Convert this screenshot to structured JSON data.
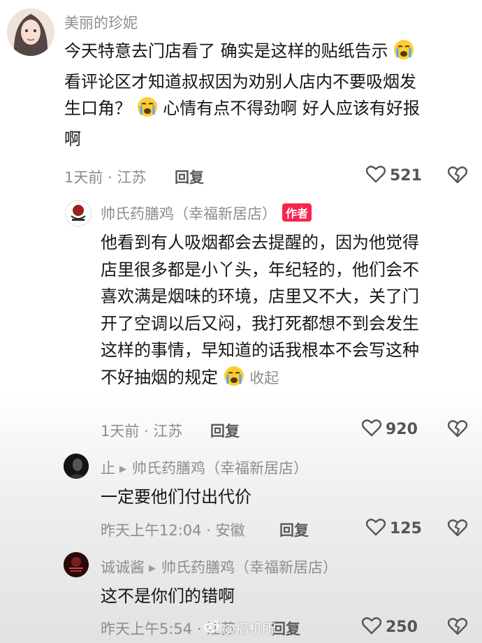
{
  "comments": [
    {
      "username": "美丽的珍妮",
      "text_lines": [
        "今天特意去门店看了 确实是这样的贴纸告示",
        "看评论区才知道叔叔因为劝别人店内不要吸烟发",
        "生口角？",
        "心情有点不得劲啊 好人应该有好报",
        "啊"
      ],
      "time_location": "1天前 · 江苏",
      "reply_label": "回复",
      "likes": "521"
    },
    {
      "username": "帅氏药膳鸡（幸福新居店）",
      "badge": "作者",
      "text_lines": [
        "他看到有人吸烟都会去提醒的，因为他觉得",
        "店里很多都是小丫头，年纪轻的，他们会不",
        "喜欢满是烟味的环境，店里又不大，关了门",
        "开了空调以后又闷，我打死都想不到会发生",
        "这样的事情，早知道的话我根本不会写这种",
        "不好抽烟的规定"
      ],
      "collapse_label": "收起",
      "time_location": "1天前 · 江苏",
      "reply_label": "回复",
      "likes": "920"
    },
    {
      "username": "止",
      "reply_to": "帅氏药膳鸡（幸福新居店）",
      "text": "一定要他们付出代价",
      "time_location": "昨天上午12:04 · 安徽",
      "reply_label": "回复",
      "likes": "125"
    },
    {
      "username": "诚诚酱",
      "reply_to": "帅氏药膳鸡（幸福新居店）",
      "text": "这不是你们的错啊",
      "time_location": "昨天上午5:54 · 江苏",
      "reply_label": "回复",
      "likes": "250"
    }
  ],
  "watermark": "@搞机所",
  "icons": {
    "like": "heart-outline-icon",
    "dislike": "broken-heart-icon",
    "emoji": "crying-face-emoji-icon",
    "reply_arrow": "triangle-right-icon"
  },
  "colors": {
    "badge": "#f6254d",
    "meta": "#8d8d8d",
    "text": "#161616"
  }
}
